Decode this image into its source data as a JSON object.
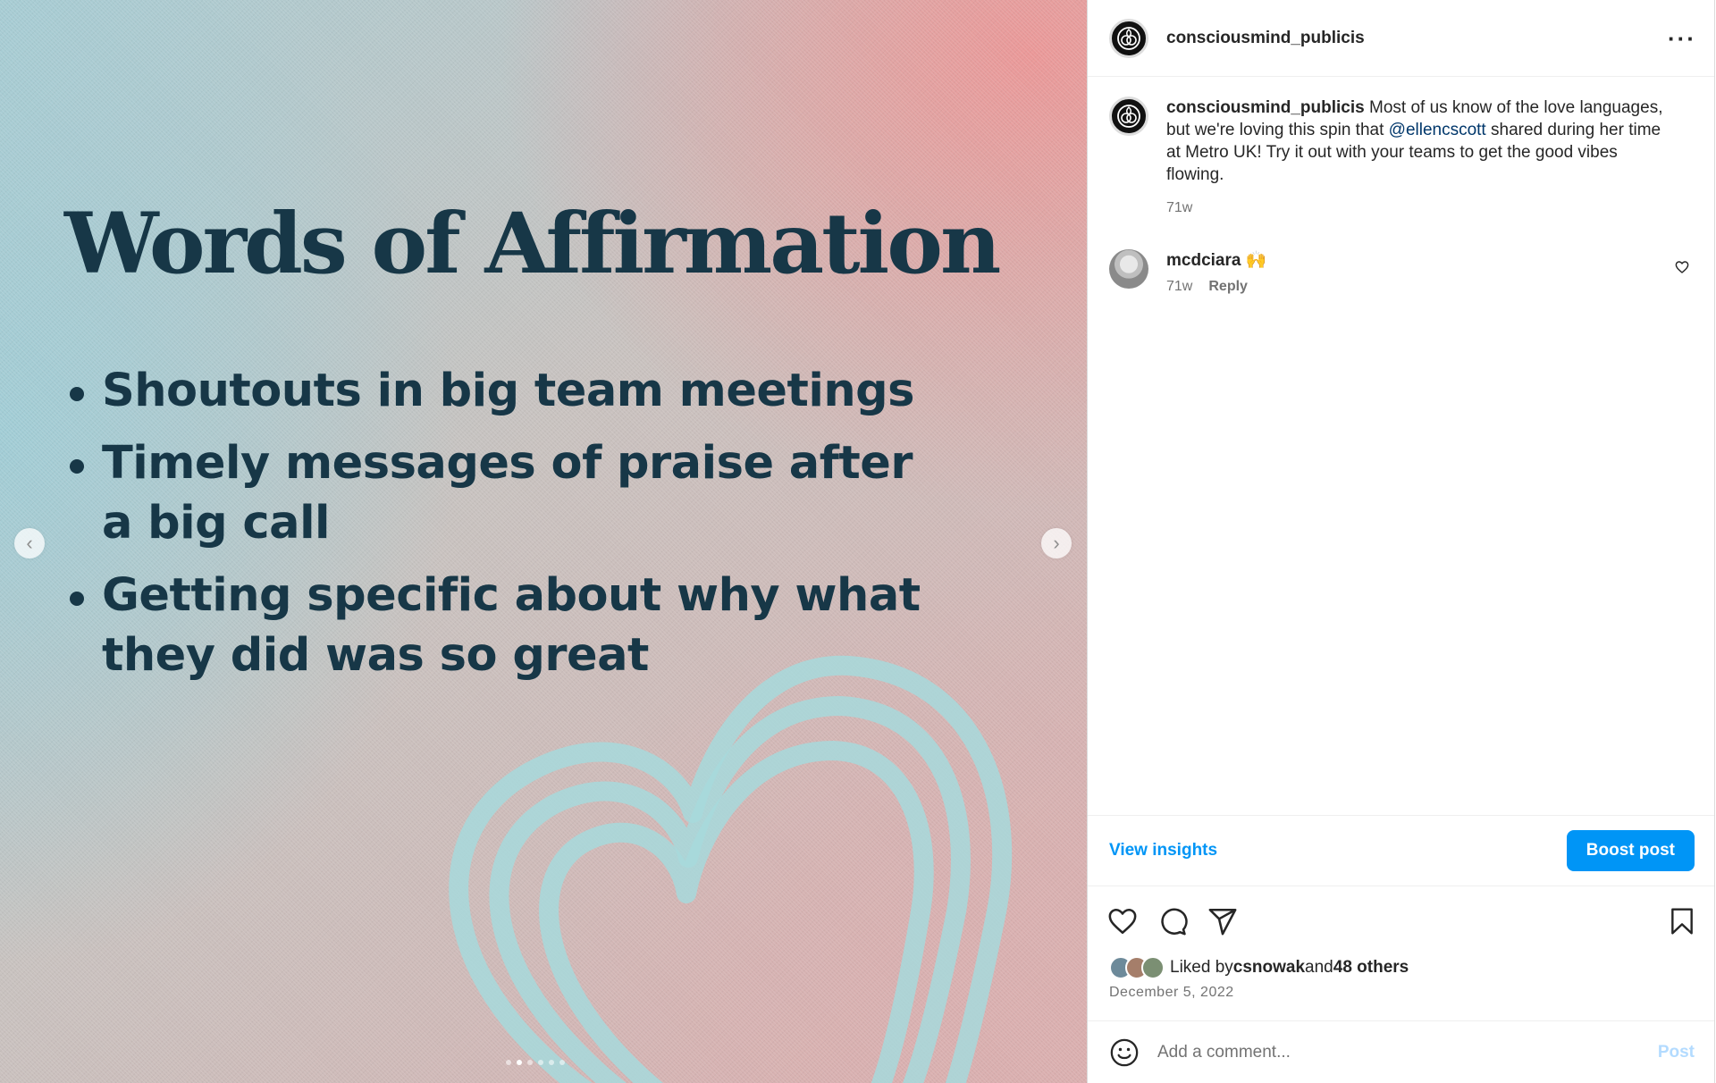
{
  "colors": {
    "accent": "#0095f6",
    "text_primary": "#262626",
    "text_secondary": "#737373",
    "mention": "#00376b",
    "slide_text": "#173747"
  },
  "media": {
    "title": "Words of Affirmation",
    "bullets": [
      "Shoutouts in big team meetings",
      "Timely messages of praise after a big call",
      "Getting specific about why what they did was so great"
    ],
    "prev_icon": "chevron-left-icon",
    "next_icon": "chevron-right-icon",
    "prev_glyph": "‹",
    "next_glyph": "›",
    "slide_count": 6,
    "active_slide": 2
  },
  "header": {
    "username": "consciousmind_publicis",
    "more_icon": "more-options-icon",
    "more_glyph": "···"
  },
  "caption": {
    "username": "consciousmind_publicis",
    "text_before": " Most of us know of the love languages, but we're loving this spin that ",
    "mention": "@ellencscott",
    "text_after": " shared during her time at Metro UK! Try it out with your teams to get the good vibes flowing.",
    "time": "71w"
  },
  "comments": [
    {
      "username": "mcdciara",
      "text": " 🙌",
      "time": "71w",
      "reply_label": "Reply"
    }
  ],
  "insights": {
    "view_label": "View insights",
    "boost_label": "Boost post"
  },
  "actions": {
    "like_icon": "heart-icon",
    "comment_icon": "comment-icon",
    "share_icon": "share-icon",
    "save_icon": "bookmark-icon"
  },
  "likes": {
    "prefix": "Liked by ",
    "user": "csnowak",
    "middle": " and ",
    "others": "48 others"
  },
  "date": "December 5, 2022",
  "add_comment": {
    "placeholder": "Add a comment...",
    "post_label": "Post",
    "emoji_icon": "emoji-icon"
  }
}
